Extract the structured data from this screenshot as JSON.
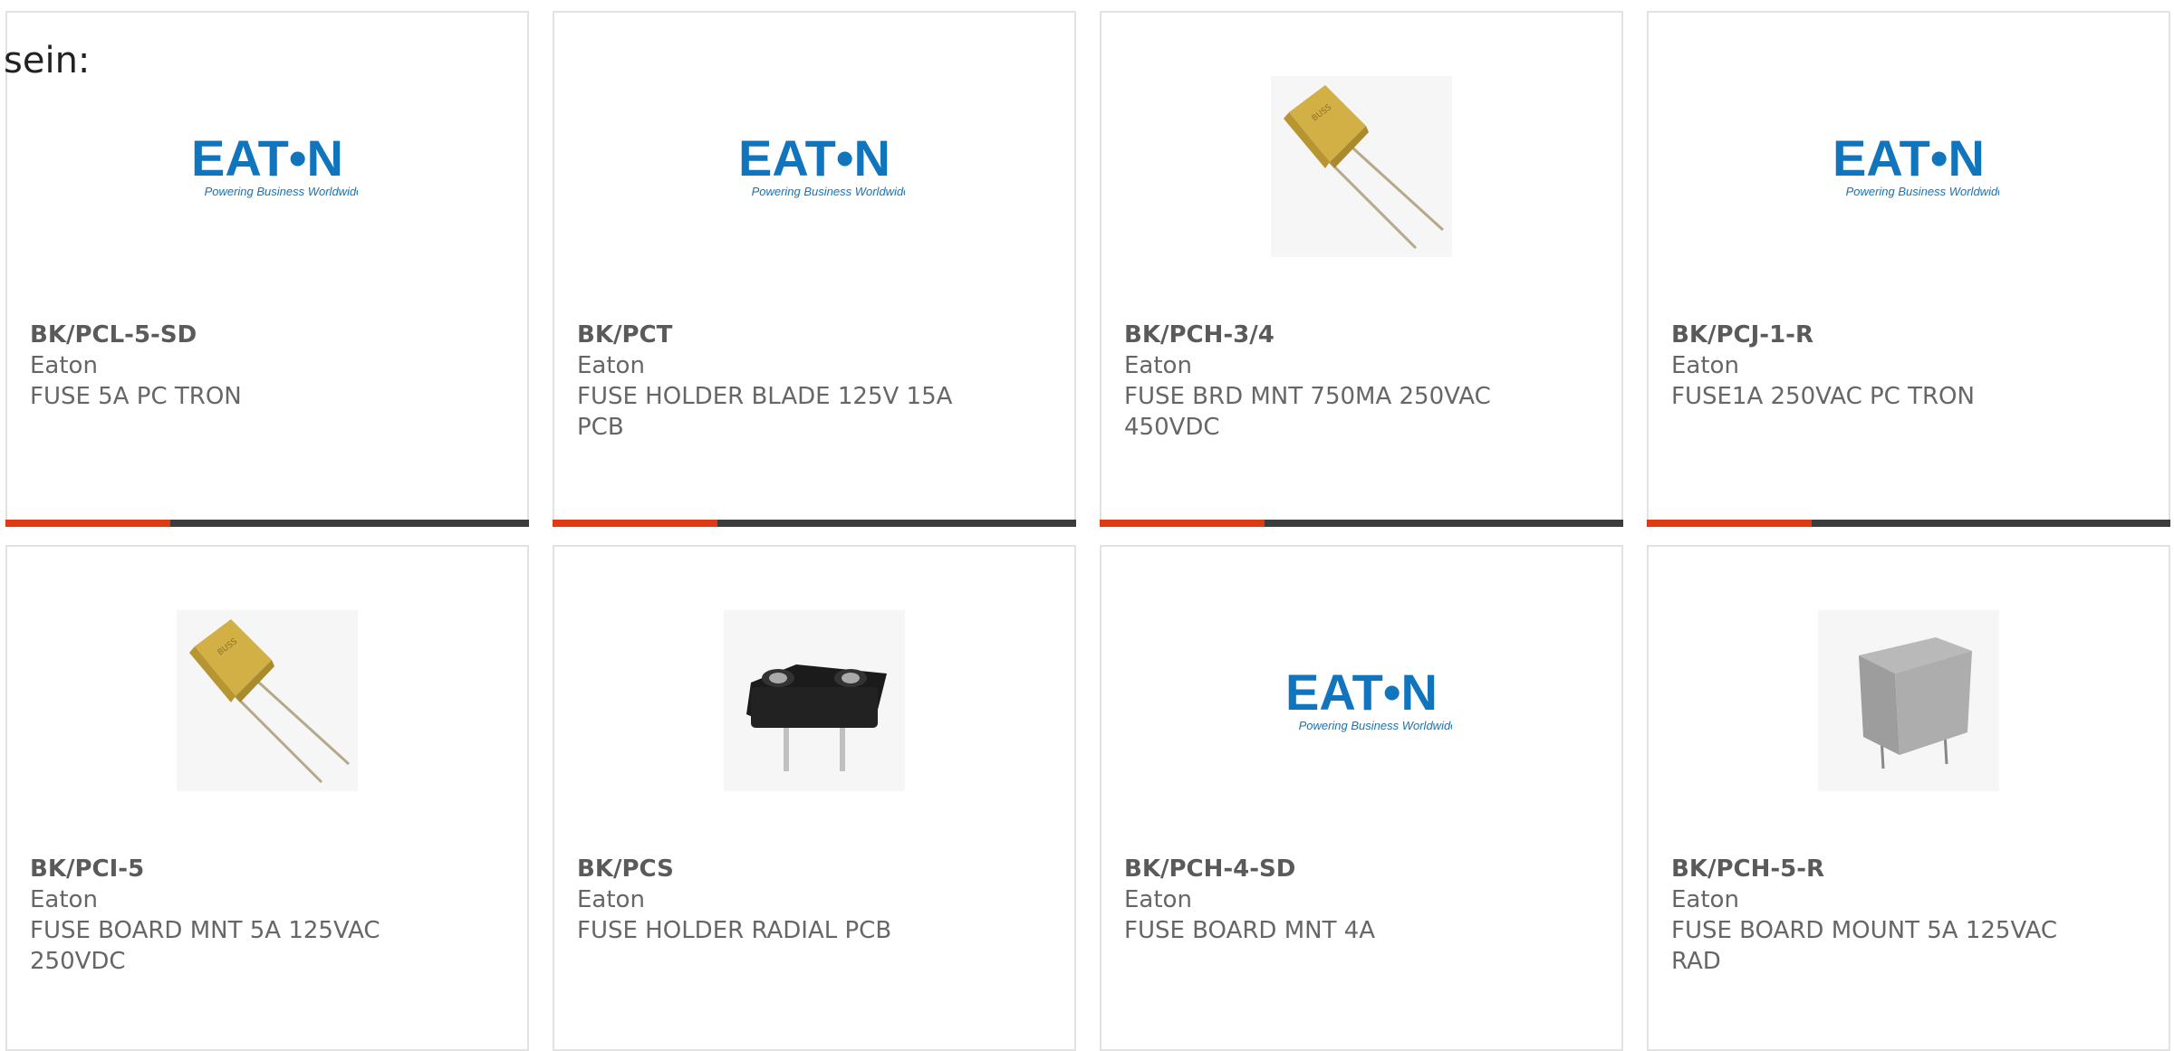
{
  "intro_text": "sein:",
  "colors": {
    "accent": "#e03a12",
    "bar": "#3c3c3c",
    "eaton_blue": "#1075bc"
  },
  "products": [
    {
      "part_number": "BK/PCL-5-SD",
      "manufacturer": "Eaton",
      "description": "FUSE 5A PC TRON",
      "image": "eaton-logo",
      "logo_tagline": "Powering Business Worldwide",
      "logo_text": "EAT•N"
    },
    {
      "part_number": "BK/PCT",
      "manufacturer": "Eaton",
      "description": "FUSE HOLDER BLADE 125V 15A PCB",
      "image": "eaton-logo",
      "logo_tagline": "Powering Business Worldwide",
      "logo_text": "EAT•N"
    },
    {
      "part_number": "BK/PCH-3/4",
      "manufacturer": "Eaton",
      "description": "FUSE BRD MNT 750MA 250VAC 450VDC",
      "image": "yellow-fuse"
    },
    {
      "part_number": "BK/PCJ-1-R",
      "manufacturer": "Eaton",
      "description": "FUSE1A 250VAC PC TRON",
      "image": "eaton-logo",
      "logo_tagline": "Powering Business Worldwide",
      "logo_text": "EAT•N"
    },
    {
      "part_number": "BK/PCI-5",
      "manufacturer": "Eaton",
      "description": "FUSE BOARD MNT 5A 125VAC 250VDC",
      "image": "yellow-fuse"
    },
    {
      "part_number": "BK/PCS",
      "manufacturer": "Eaton",
      "description": "FUSE HOLDER RADIAL PCB",
      "image": "black-holder"
    },
    {
      "part_number": "BK/PCH-4-SD",
      "manufacturer": "Eaton",
      "description": "FUSE BOARD MNT 4A",
      "image": "eaton-logo",
      "logo_tagline": "Powering Business Worldwide",
      "logo_text": "EAT•N"
    },
    {
      "part_number": "BK/PCH-5-R",
      "manufacturer": "Eaton",
      "description": "FUSE BOARD MOUNT 5A 125VAC RAD",
      "image": "gray-fuse"
    }
  ]
}
